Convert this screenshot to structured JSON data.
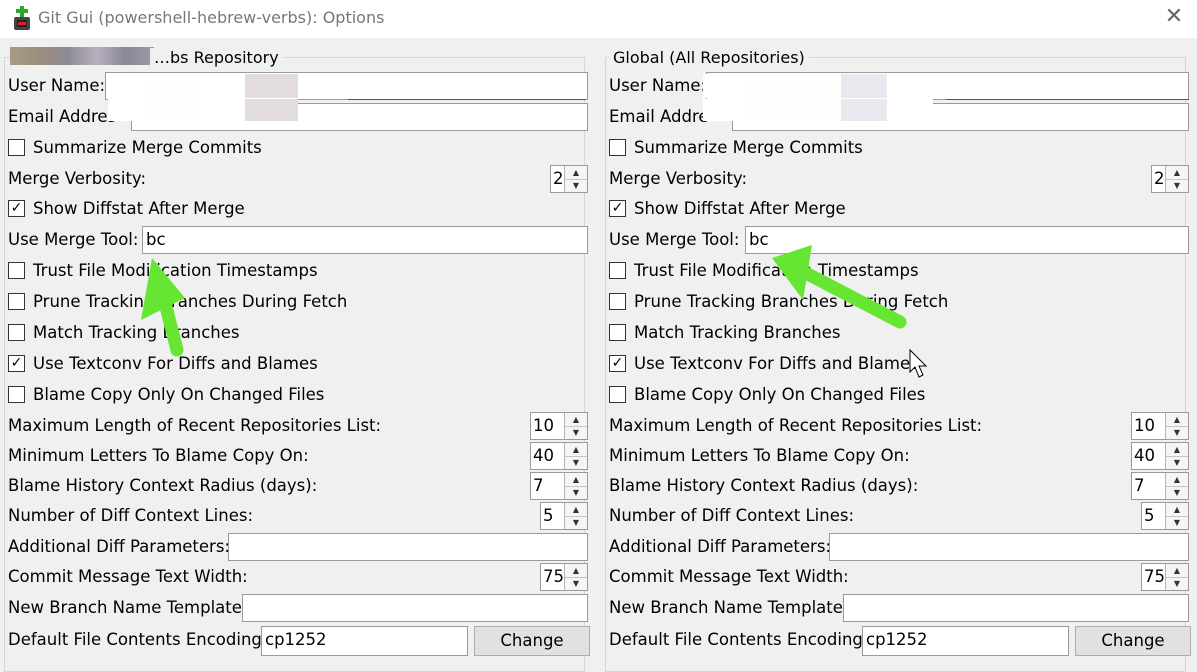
{
  "window": {
    "title": "Git Gui (powershell-hebrew-verbs): Options",
    "close_glyph": "✕"
  },
  "left": {
    "title": "…bs Repository",
    "user_name_label": "User Name:",
    "user_name_value": "",
    "email_label": "Email Addres",
    "email_value": "",
    "summarize_label": "Summarize Merge Commits",
    "summarize_checked": false,
    "verbosity_label": "Merge Verbosity:",
    "verbosity_value": "2",
    "diffstat_label": "Show Diffstat After Merge",
    "diffstat_checked": true,
    "merge_tool_label": "Use Merge Tool:",
    "merge_tool_value": "bc",
    "trust_label": "Trust File Modification Timestamps",
    "trust_checked": false,
    "prune_label": "Prune Tracking Branches During Fetch",
    "prune_checked": false,
    "match_label": "Match Tracking Branches",
    "match_checked": false,
    "textconv_label": "Use Textconv For Diffs and Blames",
    "textconv_checked": true,
    "blame_copy_label": "Blame Copy Only On Changed Files",
    "blame_copy_checked": false,
    "max_recent_label": "Maximum Length of Recent Repositories List:",
    "max_recent_value": "10",
    "min_letters_label": "Minimum Letters To Blame Copy On:",
    "min_letters_value": "40",
    "blame_radius_label": "Blame History Context Radius (days):",
    "blame_radius_value": "7",
    "diff_lines_label": "Number of Diff Context Lines:",
    "diff_lines_value": "5",
    "add_diff_label": "Additional Diff Parameters:",
    "add_diff_value": "",
    "commit_width_label": "Commit Message Text Width:",
    "commit_width_value": "75",
    "branch_template_label": "New Branch Name Template:",
    "branch_template_value": "",
    "encoding_label": "Default File Contents Encoding:",
    "encoding_value": "cp1252",
    "change_button": "Change"
  },
  "right": {
    "title": "Global (All Repositories)",
    "user_name_label": "User Name:",
    "user_name_value": "",
    "email_label": "Email Addre",
    "email_value": "",
    "summarize_label": "Summarize Merge Commits",
    "summarize_checked": false,
    "verbosity_label": "Merge Verbosity:",
    "verbosity_value": "2",
    "diffstat_label": "Show Diffstat After Merge",
    "diffstat_checked": true,
    "merge_tool_label": "Use Merge Tool:",
    "merge_tool_value": "bc",
    "trust_label": "Trust File Modification Timestamps",
    "trust_checked": false,
    "prune_label": "Prune Tracking Branches During Fetch",
    "prune_checked": false,
    "match_label": "Match Tracking Branches",
    "match_checked": false,
    "textconv_label": "Use Textconv For Diffs and Blames",
    "textconv_checked": true,
    "blame_copy_label": "Blame Copy Only On Changed Files",
    "blame_copy_checked": false,
    "max_recent_label": "Maximum Length of Recent Repositories List:",
    "max_recent_value": "10",
    "min_letters_label": "Minimum Letters To Blame Copy On:",
    "min_letters_value": "40",
    "blame_radius_label": "Blame History Context Radius (days):",
    "blame_radius_value": "7",
    "diff_lines_label": "Number of Diff Context Lines:",
    "diff_lines_value": "5",
    "add_diff_label": "Additional Diff Parameters:",
    "add_diff_value": "",
    "commit_width_label": "Commit Message Text Width:",
    "commit_width_value": "75",
    "branch_template_label": "New Branch Name Template:",
    "branch_template_value": "",
    "encoding_label": "Default File Contents Encoding:",
    "encoding_value": "cp1252",
    "change_button": "Change"
  },
  "colors": {
    "arrow": "#66e633",
    "window_bg": "#f0f0f0"
  },
  "icons": {
    "app": "git-gui-icon",
    "cursor": "mouse-pointer-icon"
  }
}
